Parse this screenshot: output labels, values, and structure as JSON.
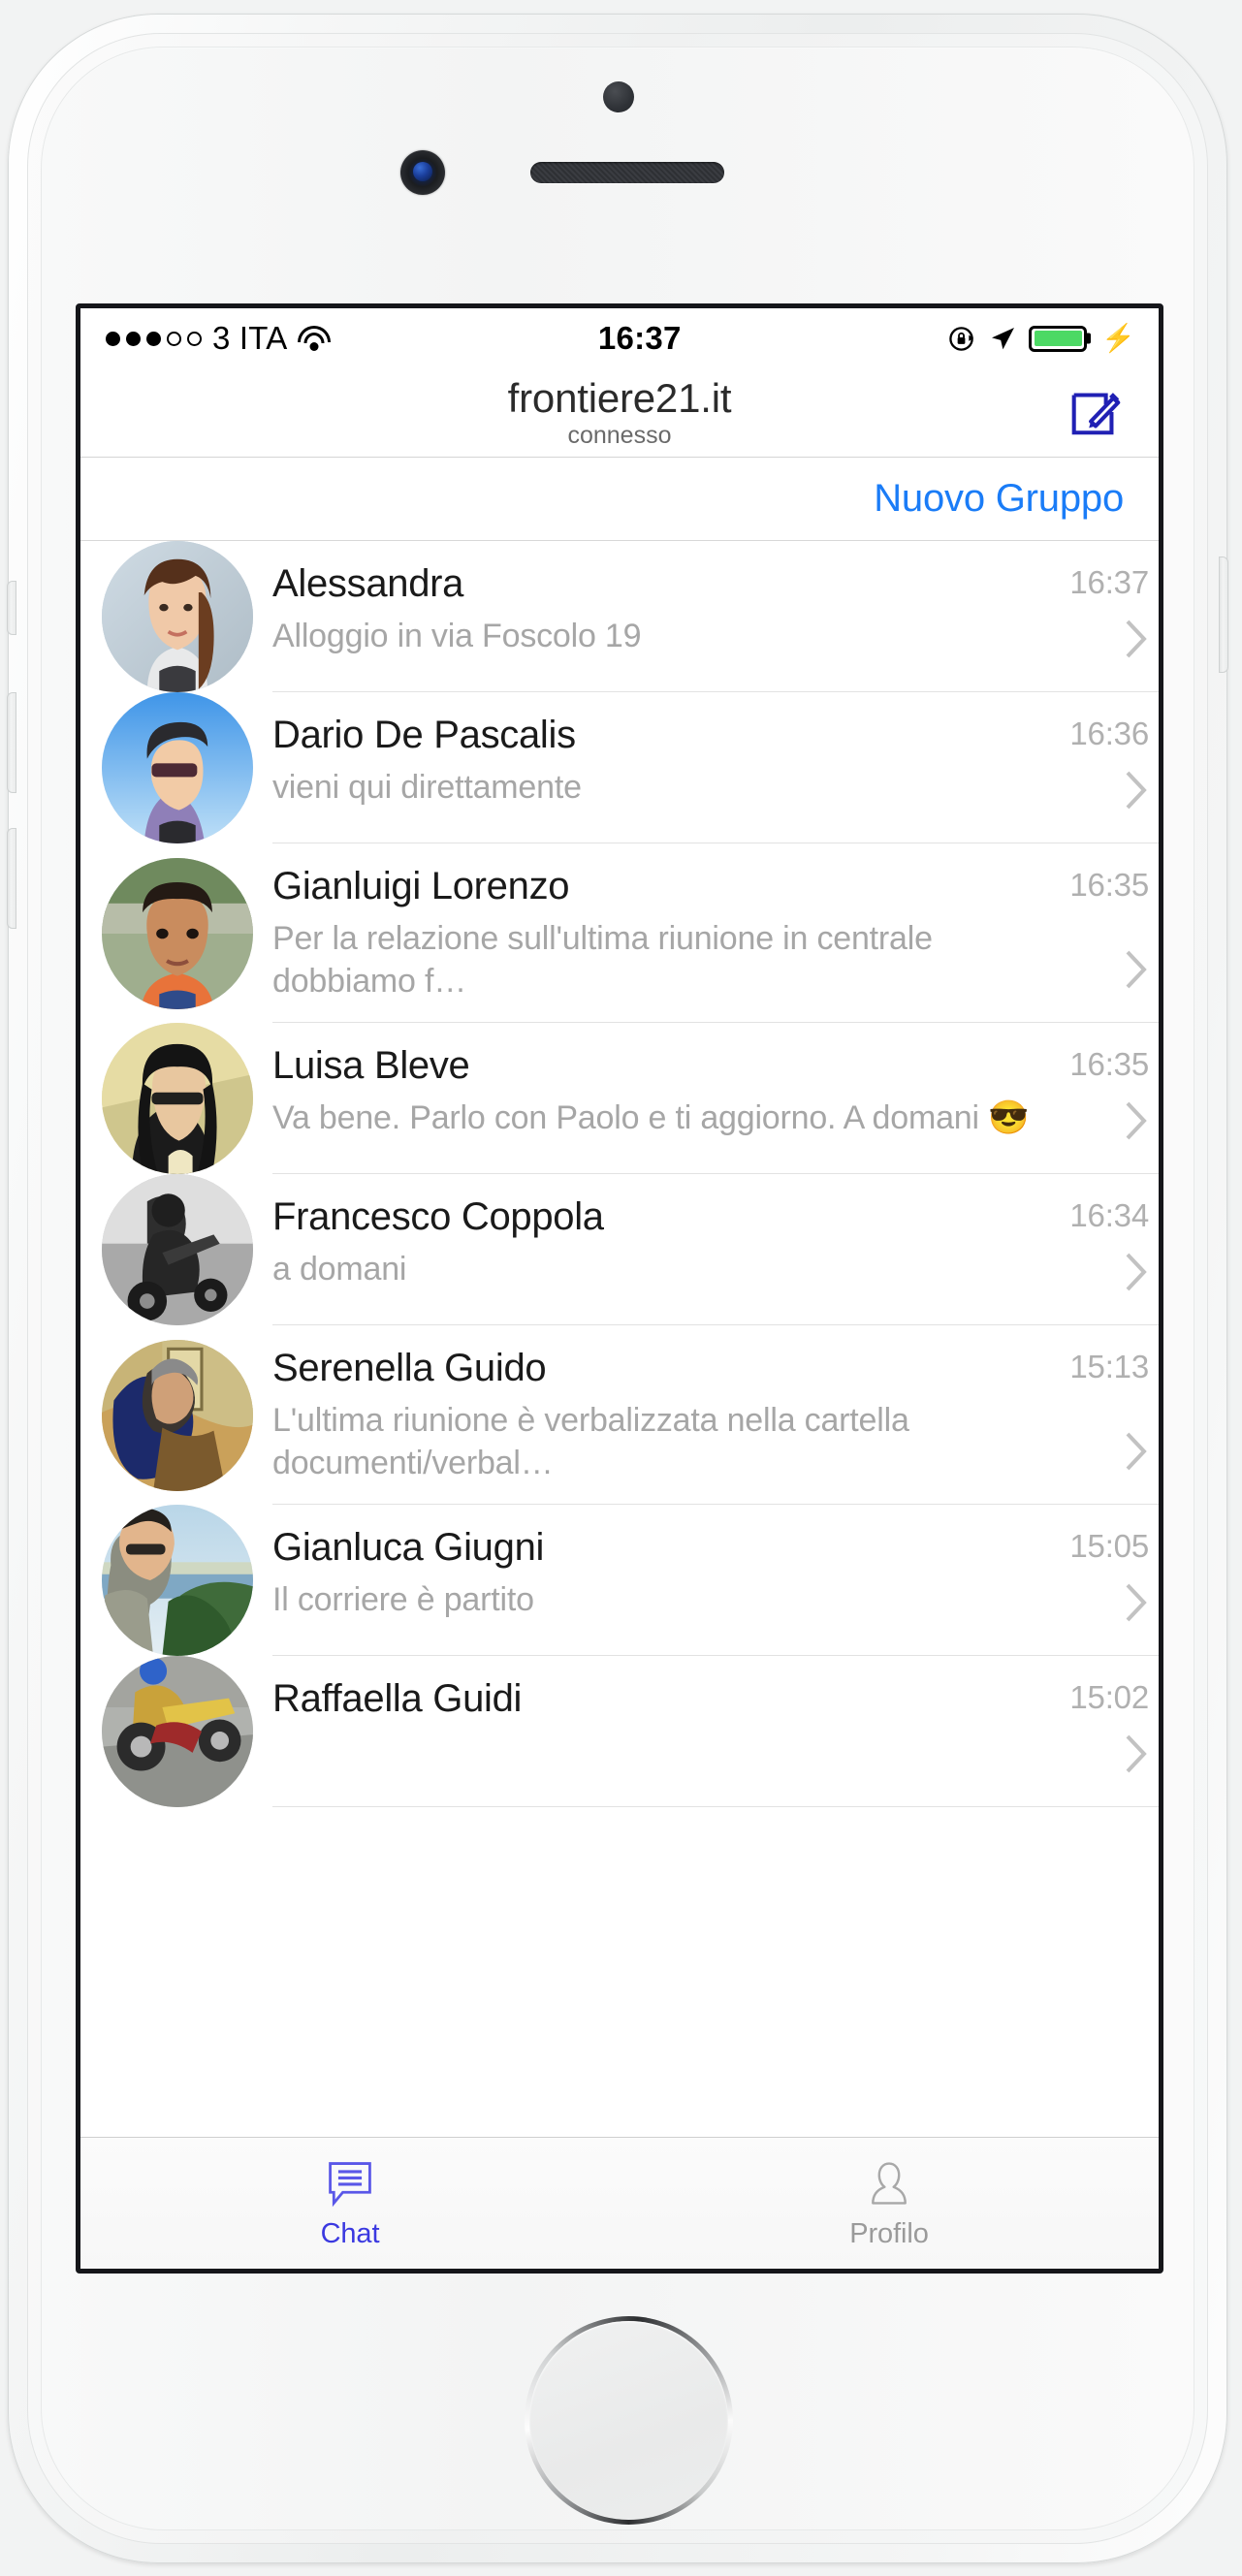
{
  "device": {
    "frame_name": "white-iphone",
    "sensors": [
      "proximity-sensor",
      "front-camera",
      "earpiece-speaker"
    ],
    "home_button": "home-button"
  },
  "statusbar": {
    "signal_dots_filled": 3,
    "signal_dots_total": 5,
    "carrier": "3 ITA",
    "wifi_icon": "wifi-icon",
    "time": "16:37",
    "rotation_lock_icon": "rotation-lock-icon",
    "location_icon": "location-arrow-icon",
    "battery_icon": "battery-icon",
    "battery_color": "#4cd964",
    "charging_icon": "lightning-bolt-icon"
  },
  "navbar": {
    "title": "frontiere21.it",
    "subtitle": "connesso",
    "compose_icon": "compose-icon",
    "compose_color": "#2020b4"
  },
  "toolbar": {
    "new_group_label": "Nuovo Gruppo",
    "new_group_color": "#1a7cf7"
  },
  "chats": [
    {
      "avatar": "avatar-alessandra",
      "name": "Alessandra",
      "preview": "Alloggio in via Foscolo 19",
      "time": "16:37",
      "chevron": "chevron-right-icon"
    },
    {
      "avatar": "avatar-dario",
      "name": "Dario De Pascalis",
      "preview": "vieni qui direttamente",
      "time": "16:36",
      "chevron": "chevron-right-icon"
    },
    {
      "avatar": "avatar-gianluigi",
      "name": "Gianluigi Lorenzo",
      "preview": "Per la relazione sull'ultima riunione in centrale dobbiamo f…",
      "time": "16:35",
      "chevron": "chevron-right-icon"
    },
    {
      "avatar": "avatar-luisa",
      "name": "Luisa Bleve",
      "preview": "Va bene. Parlo con Paolo e ti aggiorno. A domani 😎",
      "time": "16:35",
      "chevron": "chevron-right-icon"
    },
    {
      "avatar": "avatar-francesco",
      "name": "Francesco Coppola",
      "preview": "a domani",
      "time": "16:34",
      "chevron": "chevron-right-icon"
    },
    {
      "avatar": "avatar-serenella",
      "name": "Serenella Guido",
      "preview": "L'ultima riunione è verbalizzata nella cartella documenti/verbal…",
      "time": "15:13",
      "chevron": "chevron-right-icon"
    },
    {
      "avatar": "avatar-gianluca",
      "name": "Gianluca Giugni",
      "preview": "Il corriere è partito",
      "time": "15:05",
      "chevron": "chevron-right-icon"
    },
    {
      "avatar": "avatar-raffaella",
      "name": "Raffaella Guidi",
      "preview": "",
      "time": "15:02",
      "chevron": "chevron-right-icon"
    }
  ],
  "tabbar": {
    "tabs": [
      {
        "label": "Chat",
        "icon": "chat-bubble-icon",
        "active": true,
        "color": "#3b39e0"
      },
      {
        "label": "Profilo",
        "icon": "person-icon",
        "active": false,
        "color": "#9a9a9a"
      }
    ]
  }
}
